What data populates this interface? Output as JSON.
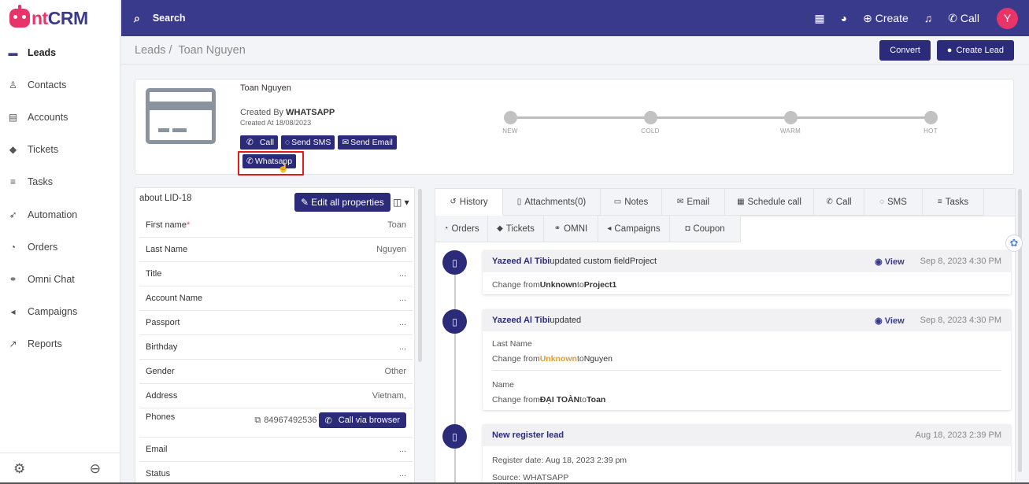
{
  "brand": {
    "logo_a": "nt",
    "logo_b": "CRM",
    "primary": "#3a3a8c",
    "accent": "#e7356a"
  },
  "sidebar": {
    "items": [
      {
        "label": "Leads",
        "icon": "leads-icon",
        "glyph": "▬"
      },
      {
        "label": "Contacts",
        "icon": "contacts-icon",
        "glyph": "♙"
      },
      {
        "label": "Accounts",
        "icon": "accounts-icon",
        "glyph": "▤"
      },
      {
        "label": "Tickets",
        "icon": "tickets-icon",
        "glyph": "◆"
      },
      {
        "label": "Tasks",
        "icon": "tasks-icon",
        "glyph": "≡"
      },
      {
        "label": "Automation",
        "icon": "rocket-icon",
        "glyph": "➶"
      },
      {
        "label": "Orders",
        "icon": "orders-icon",
        "glyph": "◔"
      },
      {
        "label": "Omni Chat",
        "icon": "omni-chat-icon",
        "glyph": "⚭"
      },
      {
        "label": "Campaigns",
        "icon": "megaphone-icon",
        "glyph": "◂"
      },
      {
        "label": "Reports",
        "icon": "reports-icon",
        "glyph": "↗"
      }
    ]
  },
  "topbar": {
    "search": "Search",
    "create": "Create",
    "call": "Call",
    "avatar": "Y"
  },
  "breadcrumb": {
    "root": "Leads",
    "current": "Toan Nguyen"
  },
  "actions": {
    "convert": "Convert",
    "create_lead": "Create Lead"
  },
  "lead": {
    "name": "Toan Nguyen",
    "created_by_label": "Created By ",
    "created_by": "WHATSAPP",
    "created_at": "Created At 18/08/2023",
    "buttons": {
      "call": "Call",
      "sms": "Send SMS",
      "email": "Send Email",
      "whatsapp": "Whatsapp"
    },
    "stages": [
      "NEW",
      "COLD",
      "WARM",
      "HOT"
    ]
  },
  "properties": {
    "title": "about LID-18",
    "edit_label": "Edit all properties",
    "rows": [
      {
        "key": "First name",
        "value": "Toan",
        "required": "*"
      },
      {
        "key": "Last Name",
        "value": "Nguyen"
      },
      {
        "key": "Title",
        "value": "..."
      },
      {
        "key": "Account Name",
        "value": "..."
      },
      {
        "key": "Passport",
        "value": "..."
      },
      {
        "key": "Birthday",
        "value": "..."
      },
      {
        "key": "Gender",
        "value": "Other"
      },
      {
        "key": "Address",
        "value": "Vietnam,"
      }
    ],
    "phones": {
      "key": "Phones",
      "value": "84967492536",
      "call_label": "Call via browser"
    },
    "rows2": [
      {
        "key": "Email",
        "value": "..."
      },
      {
        "key": "Status",
        "value": "..."
      }
    ]
  },
  "tabs": {
    "row1": [
      {
        "label": "History",
        "glyph": "↺"
      },
      {
        "label": "Attachments(0)",
        "glyph": "▯"
      },
      {
        "label": "Notes",
        "glyph": "▭"
      },
      {
        "label": "Email",
        "glyph": "✉"
      },
      {
        "label": "Schedule call",
        "glyph": "▦"
      },
      {
        "label": "Call",
        "glyph": "✆"
      },
      {
        "label": "SMS",
        "glyph": "◌"
      },
      {
        "label": "Tasks",
        "glyph": "≡"
      }
    ],
    "row2": [
      {
        "label": "Orders",
        "glyph": "◔"
      },
      {
        "label": "Tickets",
        "glyph": "◆"
      },
      {
        "label": "OMNI",
        "glyph": "⚭"
      },
      {
        "label": "Campaigns",
        "glyph": "◂"
      },
      {
        "label": "Coupon",
        "glyph": "◘"
      }
    ]
  },
  "history": [
    {
      "who": "Yazeed Al Tibi",
      "action": " updated custom fieldProject",
      "view": "View",
      "time": "Sep 8, 2023 4:30 PM",
      "line1_a": "Change from ",
      "line1_b": "Unknown",
      "line1_c": " to ",
      "line1_d": "Project1"
    },
    {
      "who": "Yazeed Al Tibi",
      "action": " updated",
      "view": "View",
      "time": "Sep 8, 2023 4:30 PM",
      "f1": "Last Name",
      "f1_a": "Change from ",
      "f1_b": "Unknown",
      "f1_c": " to ",
      "f1_d": "Nguyen",
      "f2": "Name",
      "f2_a": "Change from ",
      "f2_b": "ĐẠI TOÀN",
      "f2_c": " to ",
      "f2_d": "Toan"
    },
    {
      "title": "New register lead",
      "time": "Aug 18, 2023 2:39 PM",
      "reg": "Register date: Aug 18, 2023 2:39 pm",
      "source": "Source: WHATSAPP"
    }
  ]
}
